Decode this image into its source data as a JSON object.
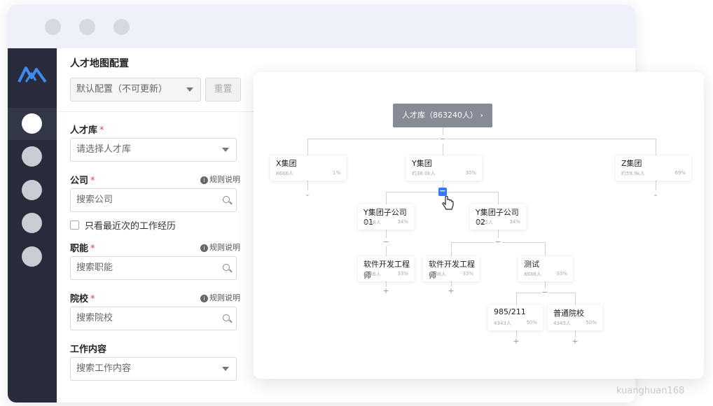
{
  "window": {
    "controls": [
      "close",
      "minimize",
      "maximize"
    ]
  },
  "sidebar": {
    "logo_icon": "mountain-logo-icon",
    "items": [
      {
        "icon": "circle-icon",
        "active": true
      },
      {
        "icon": "circle-icon",
        "active": false
      },
      {
        "icon": "circle-icon",
        "active": false
      },
      {
        "icon": "circle-icon",
        "active": false
      },
      {
        "icon": "circle-icon",
        "active": false
      }
    ]
  },
  "panel": {
    "title": "人才地图配置",
    "config_select": "默认配置（不可更新）",
    "reset_label": "重置",
    "talent_pool": {
      "label": "人才库",
      "required": "*",
      "placeholder": "请选择人才库"
    },
    "company": {
      "label": "公司",
      "required": "*",
      "rule": "规则说明",
      "placeholder": "搜索公司"
    },
    "recent_only": "只看最近次的工作经历",
    "function": {
      "label": "职能",
      "required": "*",
      "rule": "规则说明",
      "placeholder": "搜索职能"
    },
    "school": {
      "label": "院校",
      "required": "*",
      "rule": "规则说明",
      "placeholder": "搜索院校"
    },
    "work_content": {
      "label": "工作内容",
      "placeholder": "搜索工作内容"
    }
  },
  "tree": {
    "root": "人才库（863240人） ›",
    "nodes": {
      "x": {
        "name": "X集团",
        "count": "8686人",
        "pct": "1%"
      },
      "y": {
        "name": "Y集团",
        "count": "约36.0k人",
        "pct": "30%"
      },
      "z": {
        "name": "Z集团",
        "count": "约59.9k人",
        "pct": "69%"
      },
      "y1": {
        "name": "Y集团子公司01",
        "count": "8628人",
        "pct": "34%"
      },
      "y2": {
        "name": "Y集团子公司02",
        "count": "8612人",
        "pct": "34%"
      },
      "se1": {
        "name": "软件开发工程师",
        "count": "8686人",
        "pct": "33%"
      },
      "se2": {
        "name": "软件开发工程师",
        "count": "8686人",
        "pct": "33%"
      },
      "test": {
        "name": "测试",
        "count": "8686人",
        "pct": "33%"
      },
      "s985": {
        "name": "985/211",
        "count": "4343人",
        "pct": "50%"
      },
      "normal": {
        "name": "普通院校",
        "count": "4343人",
        "pct": "50%"
      }
    }
  },
  "watermark": "kuanghuan168"
}
